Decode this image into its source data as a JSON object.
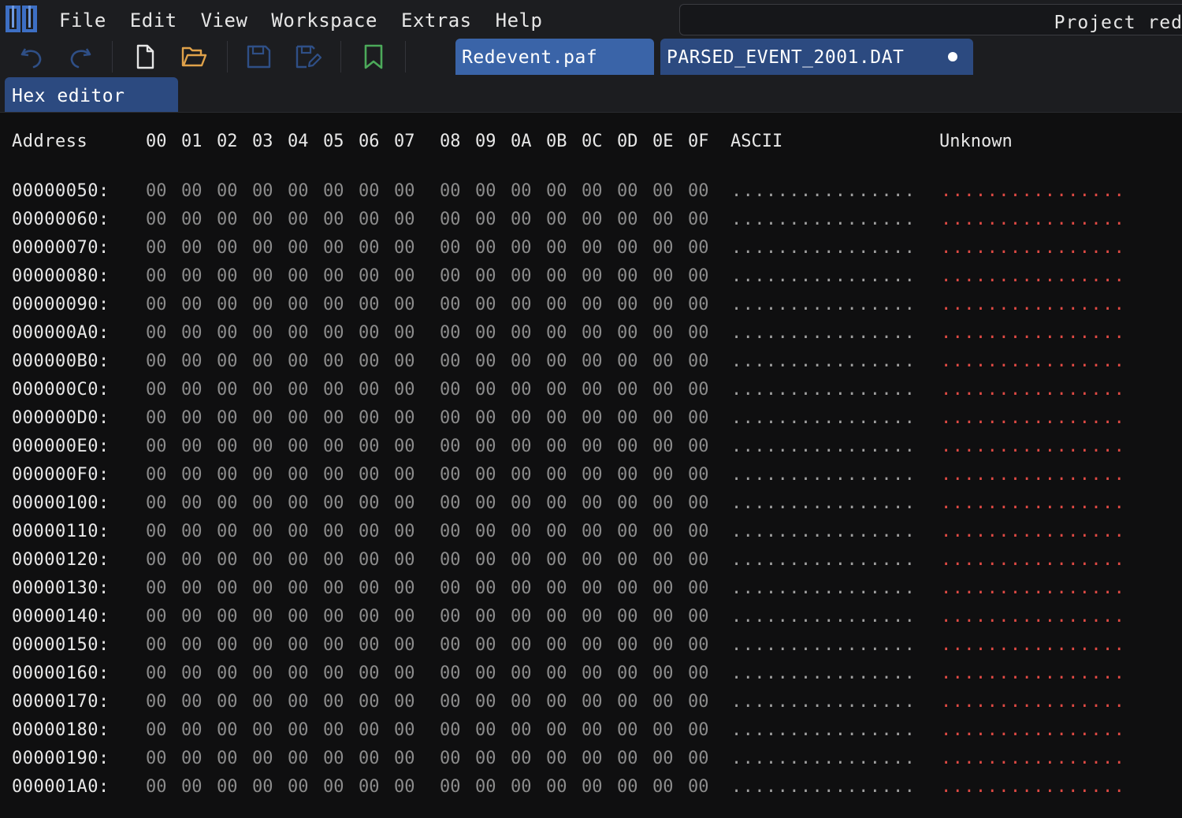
{
  "menu": {
    "file": "File",
    "edit": "Edit",
    "view": "View",
    "workspace": "Workspace",
    "extras": "Extras",
    "help": "Help"
  },
  "project": {
    "name": "Project red"
  },
  "toolbar": {
    "icons": [
      "undo-icon",
      "redo-icon",
      "new-file-icon",
      "open-folder-icon",
      "save-icon",
      "save-as-icon",
      "bookmark-icon"
    ]
  },
  "tabs": {
    "redevent": "Redevent.paf",
    "parsed": "PARSED_EVENT_2001.DAT",
    "parsed_unsaved": true
  },
  "panel": {
    "title": "Hex editor"
  },
  "hex": {
    "address_header": "Address",
    "byte_headers": [
      "00",
      "01",
      "02",
      "03",
      "04",
      "05",
      "06",
      "07",
      "08",
      "09",
      "0A",
      "0B",
      "0C",
      "0D",
      "0E",
      "0F"
    ],
    "ascii_header": "ASCII",
    "unknown_header": "Unknown",
    "rows": [
      {
        "address": "00000050:",
        "bytes": [
          "00",
          "00",
          "00",
          "00",
          "00",
          "00",
          "00",
          "00",
          "00",
          "00",
          "00",
          "00",
          "00",
          "00",
          "00",
          "00"
        ],
        "ascii": "................",
        "unknown": "................"
      },
      {
        "address": "00000060:",
        "bytes": [
          "00",
          "00",
          "00",
          "00",
          "00",
          "00",
          "00",
          "00",
          "00",
          "00",
          "00",
          "00",
          "00",
          "00",
          "00",
          "00"
        ],
        "ascii": "................",
        "unknown": "................"
      },
      {
        "address": "00000070:",
        "bytes": [
          "00",
          "00",
          "00",
          "00",
          "00",
          "00",
          "00",
          "00",
          "00",
          "00",
          "00",
          "00",
          "00",
          "00",
          "00",
          "00"
        ],
        "ascii": "................",
        "unknown": "................"
      },
      {
        "address": "00000080:",
        "bytes": [
          "00",
          "00",
          "00",
          "00",
          "00",
          "00",
          "00",
          "00",
          "00",
          "00",
          "00",
          "00",
          "00",
          "00",
          "00",
          "00"
        ],
        "ascii": "................",
        "unknown": "................"
      },
      {
        "address": "00000090:",
        "bytes": [
          "00",
          "00",
          "00",
          "00",
          "00",
          "00",
          "00",
          "00",
          "00",
          "00",
          "00",
          "00",
          "00",
          "00",
          "00",
          "00"
        ],
        "ascii": "................",
        "unknown": "................"
      },
      {
        "address": "000000A0:",
        "bytes": [
          "00",
          "00",
          "00",
          "00",
          "00",
          "00",
          "00",
          "00",
          "00",
          "00",
          "00",
          "00",
          "00",
          "00",
          "00",
          "00"
        ],
        "ascii": "................",
        "unknown": "................"
      },
      {
        "address": "000000B0:",
        "bytes": [
          "00",
          "00",
          "00",
          "00",
          "00",
          "00",
          "00",
          "00",
          "00",
          "00",
          "00",
          "00",
          "00",
          "00",
          "00",
          "00"
        ],
        "ascii": "................",
        "unknown": "................"
      },
      {
        "address": "000000C0:",
        "bytes": [
          "00",
          "00",
          "00",
          "00",
          "00",
          "00",
          "00",
          "00",
          "00",
          "00",
          "00",
          "00",
          "00",
          "00",
          "00",
          "00"
        ],
        "ascii": "................",
        "unknown": "................"
      },
      {
        "address": "000000D0:",
        "bytes": [
          "00",
          "00",
          "00",
          "00",
          "00",
          "00",
          "00",
          "00",
          "00",
          "00",
          "00",
          "00",
          "00",
          "00",
          "00",
          "00"
        ],
        "ascii": "................",
        "unknown": "................"
      },
      {
        "address": "000000E0:",
        "bytes": [
          "00",
          "00",
          "00",
          "00",
          "00",
          "00",
          "00",
          "00",
          "00",
          "00",
          "00",
          "00",
          "00",
          "00",
          "00",
          "00"
        ],
        "ascii": "................",
        "unknown": "................"
      },
      {
        "address": "000000F0:",
        "bytes": [
          "00",
          "00",
          "00",
          "00",
          "00",
          "00",
          "00",
          "00",
          "00",
          "00",
          "00",
          "00",
          "00",
          "00",
          "00",
          "00"
        ],
        "ascii": "................",
        "unknown": "................"
      },
      {
        "address": "00000100:",
        "bytes": [
          "00",
          "00",
          "00",
          "00",
          "00",
          "00",
          "00",
          "00",
          "00",
          "00",
          "00",
          "00",
          "00",
          "00",
          "00",
          "00"
        ],
        "ascii": "................",
        "unknown": "................"
      },
      {
        "address": "00000110:",
        "bytes": [
          "00",
          "00",
          "00",
          "00",
          "00",
          "00",
          "00",
          "00",
          "00",
          "00",
          "00",
          "00",
          "00",
          "00",
          "00",
          "00"
        ],
        "ascii": "................",
        "unknown": "................"
      },
      {
        "address": "00000120:",
        "bytes": [
          "00",
          "00",
          "00",
          "00",
          "00",
          "00",
          "00",
          "00",
          "00",
          "00",
          "00",
          "00",
          "00",
          "00",
          "00",
          "00"
        ],
        "ascii": "................",
        "unknown": "................"
      },
      {
        "address": "00000130:",
        "bytes": [
          "00",
          "00",
          "00",
          "00",
          "00",
          "00",
          "00",
          "00",
          "00",
          "00",
          "00",
          "00",
          "00",
          "00",
          "00",
          "00"
        ],
        "ascii": "................",
        "unknown": "................"
      },
      {
        "address": "00000140:",
        "bytes": [
          "00",
          "00",
          "00",
          "00",
          "00",
          "00",
          "00",
          "00",
          "00",
          "00",
          "00",
          "00",
          "00",
          "00",
          "00",
          "00"
        ],
        "ascii": "................",
        "unknown": "................"
      },
      {
        "address": "00000150:",
        "bytes": [
          "00",
          "00",
          "00",
          "00",
          "00",
          "00",
          "00",
          "00",
          "00",
          "00",
          "00",
          "00",
          "00",
          "00",
          "00",
          "00"
        ],
        "ascii": "................",
        "unknown": "................"
      },
      {
        "address": "00000160:",
        "bytes": [
          "00",
          "00",
          "00",
          "00",
          "00",
          "00",
          "00",
          "00",
          "00",
          "00",
          "00",
          "00",
          "00",
          "00",
          "00",
          "00"
        ],
        "ascii": "................",
        "unknown": "................"
      },
      {
        "address": "00000170:",
        "bytes": [
          "00",
          "00",
          "00",
          "00",
          "00",
          "00",
          "00",
          "00",
          "00",
          "00",
          "00",
          "00",
          "00",
          "00",
          "00",
          "00"
        ],
        "ascii": "................",
        "unknown": "................"
      },
      {
        "address": "00000180:",
        "bytes": [
          "00",
          "00",
          "00",
          "00",
          "00",
          "00",
          "00",
          "00",
          "00",
          "00",
          "00",
          "00",
          "00",
          "00",
          "00",
          "00"
        ],
        "ascii": "................",
        "unknown": "................"
      },
      {
        "address": "00000190:",
        "bytes": [
          "00",
          "00",
          "00",
          "00",
          "00",
          "00",
          "00",
          "00",
          "00",
          "00",
          "00",
          "00",
          "00",
          "00",
          "00",
          "00"
        ],
        "ascii": "................",
        "unknown": "................"
      },
      {
        "address": "000001A0:",
        "bytes": [
          "00",
          "00",
          "00",
          "00",
          "00",
          "00",
          "00",
          "00",
          "00",
          "00",
          "00",
          "00",
          "00",
          "00",
          "00",
          "00"
        ],
        "ascii": "................",
        "unknown": "................"
      }
    ]
  },
  "colors": {
    "background": "#0f0f10",
    "chrome": "#1c1d20",
    "tab_active": "#3a64a8",
    "tab_inactive": "#2c4a80",
    "byte_text": "#8c8c8c",
    "unknown_text": "#e04a44",
    "logo_blue": "#3d6fc4"
  }
}
